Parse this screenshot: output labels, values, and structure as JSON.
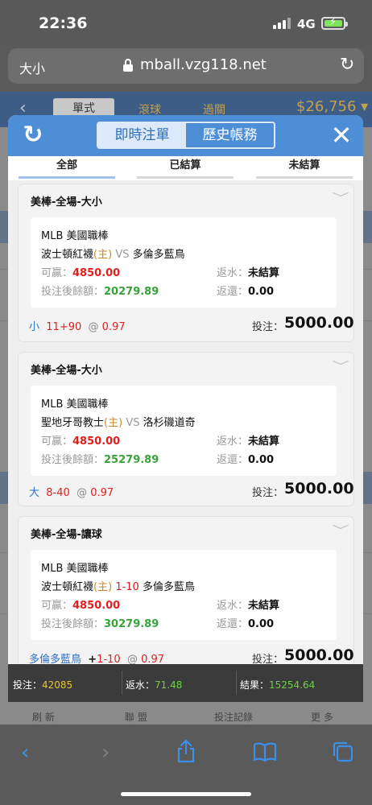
{
  "status": {
    "time": "22:36",
    "network": "4G"
  },
  "browser": {
    "text_size": "大小",
    "url": "mball.vzg118.net",
    "reload_icon": "reload-icon"
  },
  "background_page": {
    "tab_active": "單式",
    "tab_2": "滾球",
    "tab_3": "過關",
    "balance": "$26,756",
    "footer": [
      "刷 新",
      "聯 盟",
      "投注記錄",
      "更 多"
    ]
  },
  "modal": {
    "tabs": {
      "active": "即時注單",
      "inactive": "歷史帳務"
    },
    "filters": [
      "全部",
      "已結算",
      "未結算"
    ],
    "labels": {
      "win": "可贏：",
      "after": "投注後餘額：",
      "rebate": "返水：",
      "refund": "返還：",
      "stake": "投注："
    },
    "bets": [
      {
        "title": "美棒-全場-大小",
        "league": "MLB 美國職棒",
        "home": "波士頓紅襪",
        "host_mark": "(主)",
        "vs": "VS",
        "line_mid": "",
        "away": "多倫多藍鳥",
        "win_amount": "4850.00",
        "balance_after": "20279.89",
        "rebate": "未結算",
        "refund": "0.00",
        "pick": "小",
        "line": "11+90",
        "at": "@",
        "odds": "0.97",
        "stake": "5000.00"
      },
      {
        "title": "美棒-全場-大小",
        "league": "MLB 美國職棒",
        "home": "聖地牙哥教士",
        "host_mark": "(主)",
        "vs": "VS",
        "line_mid": "",
        "away": "洛杉磯道奇",
        "win_amount": "4850.00",
        "balance_after": "25279.89",
        "rebate": "未結算",
        "refund": "0.00",
        "pick": "大",
        "line": "8-40",
        "at": "@",
        "odds": "0.97",
        "stake": "5000.00"
      },
      {
        "title": "美棒-全場-讓球",
        "league": "MLB 美國職棒",
        "home": "波士頓紅襪",
        "host_mark": "(主)",
        "vs": "",
        "line_mid": "1-10",
        "away": "多倫多藍鳥",
        "win_amount": "4850.00",
        "balance_after": "30279.89",
        "rebate": "未結算",
        "refund": "0.00",
        "pick": "多倫多藍鳥",
        "plus": "+",
        "line": "1-10",
        "at": "@",
        "odds": "0.97",
        "stake": "5000.00"
      }
    ]
  },
  "summary": {
    "stake_label": "投注：",
    "stake_value": "42085",
    "rebate_label": "返水：",
    "rebate_value": "71.48",
    "result_label": "結果：",
    "result_value": "15254.64"
  },
  "colors": {
    "header_blue": "#4d8ed6",
    "win_red": "#e02020",
    "balance_green": "#3aa23a",
    "accent_gold": "#c3a04a"
  }
}
